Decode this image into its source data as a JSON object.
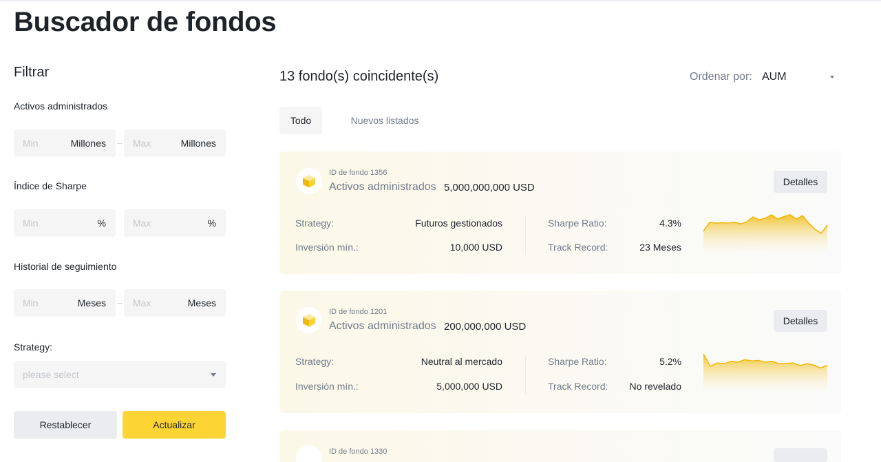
{
  "page": {
    "title": "Buscador de fondos"
  },
  "filters": {
    "title": "Filtrar",
    "aum": {
      "label": "Activos administrados",
      "min_placeholder": "Min",
      "max_placeholder": "Max",
      "unit": "Millones"
    },
    "sharpe": {
      "label": "Índice de Sharpe",
      "min_placeholder": "Min",
      "max_placeholder": "Max",
      "unit": "%"
    },
    "track": {
      "label": "Historial de seguimiento",
      "min_placeholder": "Min",
      "max_placeholder": "Max",
      "unit": "Meses"
    },
    "strategy": {
      "label": "Strategy:",
      "placeholder": "please select"
    },
    "reset_label": "Restablecer",
    "update_label": "Actualizar"
  },
  "results": {
    "count_text": "13 fondo(s) coincidente(s)",
    "sort_label": "Ordenar por:",
    "sort_value": "AUM",
    "tabs": [
      {
        "label": "Todo"
      },
      {
        "label": "Nuevos listados"
      }
    ]
  },
  "funds": [
    {
      "id_text": "ID de fondo 1356",
      "aum_label": "Activos administrados",
      "aum_value": "5,000,000,000 USD",
      "details_label": "Detalles",
      "strategy_label": "Strategy:",
      "strategy_value": "Futuros gestionados",
      "min_label": "Inversión mín.:",
      "min_value": "10,000 USD",
      "sharpe_label": "Sharpe Ratio:",
      "sharpe_value": "4.3%",
      "track_label": "Track Record:",
      "track_value": "23 Meses",
      "trend": [
        40,
        62,
        60,
        61,
        60,
        62,
        58,
        63,
        75,
        68,
        72,
        80,
        70,
        76,
        80,
        70,
        78,
        60,
        45,
        35,
        55
      ]
    },
    {
      "id_text": "ID de fondo 1201",
      "aum_label": "Activos administrados",
      "aum_value": "200,000,000 USD",
      "details_label": "Detalles",
      "strategy_label": "Strategy:",
      "strategy_value": "Neutral al mercado",
      "min_label": "Inversión mín.:",
      "min_value": "5,000,000 USD",
      "sharpe_label": "Sharpe Ratio:",
      "sharpe_value": "5.2%",
      "track_label": "Track Record:",
      "track_value": "No revelado",
      "trend": [
        80,
        50,
        58,
        56,
        62,
        60,
        66,
        63,
        64,
        60,
        62,
        56,
        57,
        58,
        52,
        56,
        53,
        46,
        52
      ]
    },
    {
      "id_text": "ID de fondo 1330"
    }
  ],
  "colors": {
    "accent": "#fcd535",
    "sparkline_line": "#f0b90b",
    "card_bg": "#fcf8e8",
    "text_primary": "#1e2329",
    "text_secondary": "#707a8a"
  }
}
